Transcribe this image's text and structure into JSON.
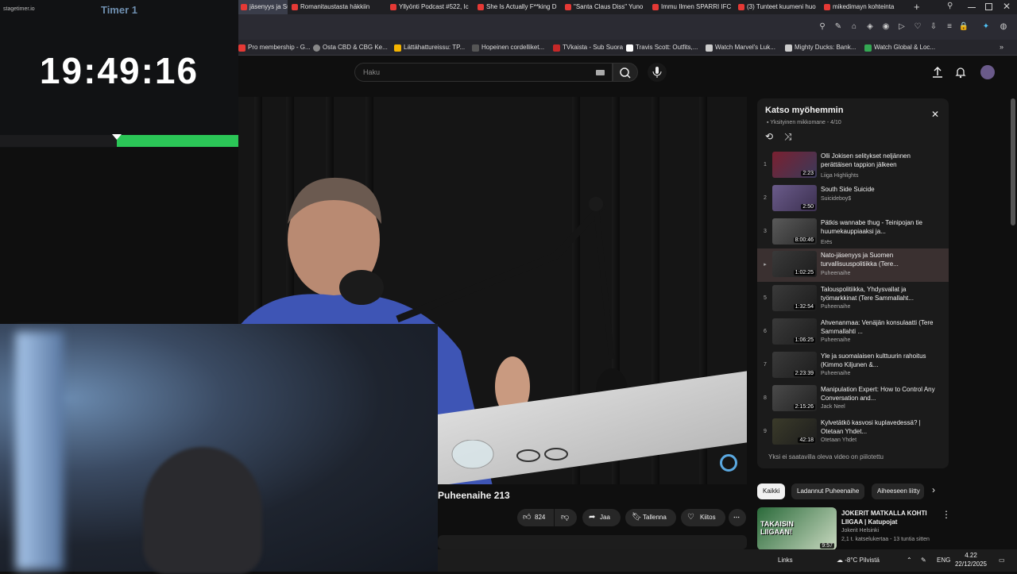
{
  "timer": {
    "app_name": "stagetimer.io",
    "title": "Timer 1",
    "time": "19:49:16",
    "progress": 0.51
  },
  "tabs": [
    {
      "label": "jäsenyys ja Suo",
      "active": true
    },
    {
      "label": "Romanitaustasta häkkiin"
    },
    {
      "label": "Yllyönti Podcast #522, Ic"
    },
    {
      "label": "She Is Actually F**king D"
    },
    {
      "label": "\"Santa Claus Diss\" Yuno"
    },
    {
      "label": "Immu Ilmen SPARRI IFC"
    },
    {
      "label": "(3) Tunteet kuumeni huo"
    },
    {
      "label": "mikedimayn kohteinta"
    }
  ],
  "bookmarks": [
    {
      "label": "Pro membership - G...",
      "color": "#e53935"
    },
    {
      "label": "Osta CBD & CBG Ke...",
      "color": "#888888"
    },
    {
      "label": "Lättähattureissu: TP...",
      "color": "#f4b400"
    },
    {
      "label": "Hopeinen cordelliket...",
      "color": "#555555"
    },
    {
      "label": "TVkaista - Sub Suora",
      "color": "#c62828"
    },
    {
      "label": "Travis Scott: Outfits,...",
      "color": "#ffffff"
    },
    {
      "label": "Watch Marvel's Luk...",
      "color": "#cccccc"
    },
    {
      "label": "Mighty Ducks: Bank...",
      "color": "#cccccc"
    },
    {
      "label": "Watch Global & Loc...",
      "color": "#34a853"
    }
  ],
  "search": {
    "placeholder": "Haku"
  },
  "playlist": {
    "title": "Katso myöhemmin",
    "subtitle": "Yksityinen mikkomane - 4/10",
    "footer": "Yksi ei saatavilla oleva video on piilotettu",
    "items": [
      {
        "index": "1",
        "title": "Olli Jokisen selitykset neljännen perättäisen tappion jälkeen",
        "channel": "Liiga Highlights",
        "duration": "2:23"
      },
      {
        "index": "2",
        "title": "South Side Suicide",
        "channel": "Suicideboy$",
        "duration": "2:50"
      },
      {
        "index": "3",
        "title": "Pätkis wannabe thug - Teinipojan tie huumekauppiaaksi ja...",
        "channel": "Erës",
        "duration": "8:00:46"
      },
      {
        "index": "▸",
        "title": "Nato-jäsenyys ja Suomen turvallisuuspolitiikka (Tere...",
        "channel": "Puheenaihe",
        "duration": "1:02:25",
        "active": true
      },
      {
        "index": "5",
        "title": "Talouspolitiikka, Yhdysvallat ja työmarkkinat (Tere Sammallaht...",
        "channel": "Puheenaihe",
        "duration": "1:32:54"
      },
      {
        "index": "6",
        "title": "Ahvenanmaa: Venäjän konsulaatti (Tere Sammallahti ...",
        "channel": "Puheenaihe",
        "duration": "1:06:25"
      },
      {
        "index": "7",
        "title": "Yle ja suomalaisen kulttuurin rahoitus (Kimmo Kiljunen &...",
        "channel": "Puheenaihe",
        "duration": "2:23:39"
      },
      {
        "index": "8",
        "title": "Manipulation Expert: How to Control Any Conversation and...",
        "channel": "Jack Neel",
        "duration": "2:15:26"
      },
      {
        "index": "9",
        "title": "Kylvetätkö kasvosi kuplavedessä? | Otetaan Yhdet...",
        "channel": "Otetaan Yhdet",
        "duration": "42:18"
      }
    ]
  },
  "chips": [
    "Kaikki",
    "Ladannut Puheenaihe",
    "Aiheeseen liitty"
  ],
  "video": {
    "title": "Puheenaihe 213",
    "likes": "824",
    "share": "Jaa",
    "save": "Tallenna",
    "thanks": "Kiitos"
  },
  "recommended": {
    "title": "JOKERIT MATKALLA KOHTI LIIGAA | Katupojat",
    "channel": "Jokerit Helsinki",
    "meta": "2,1 t. katselukertaa - 13 tuntia sitten",
    "duration": "9:57",
    "thumb_text": "TAKAISIN LIIGAAN!"
  },
  "taskbar": {
    "links": "Links",
    "weather": "-8°C Pilvistä",
    "lang": "ENG",
    "time": "4.22",
    "date": "22/12/2025"
  }
}
